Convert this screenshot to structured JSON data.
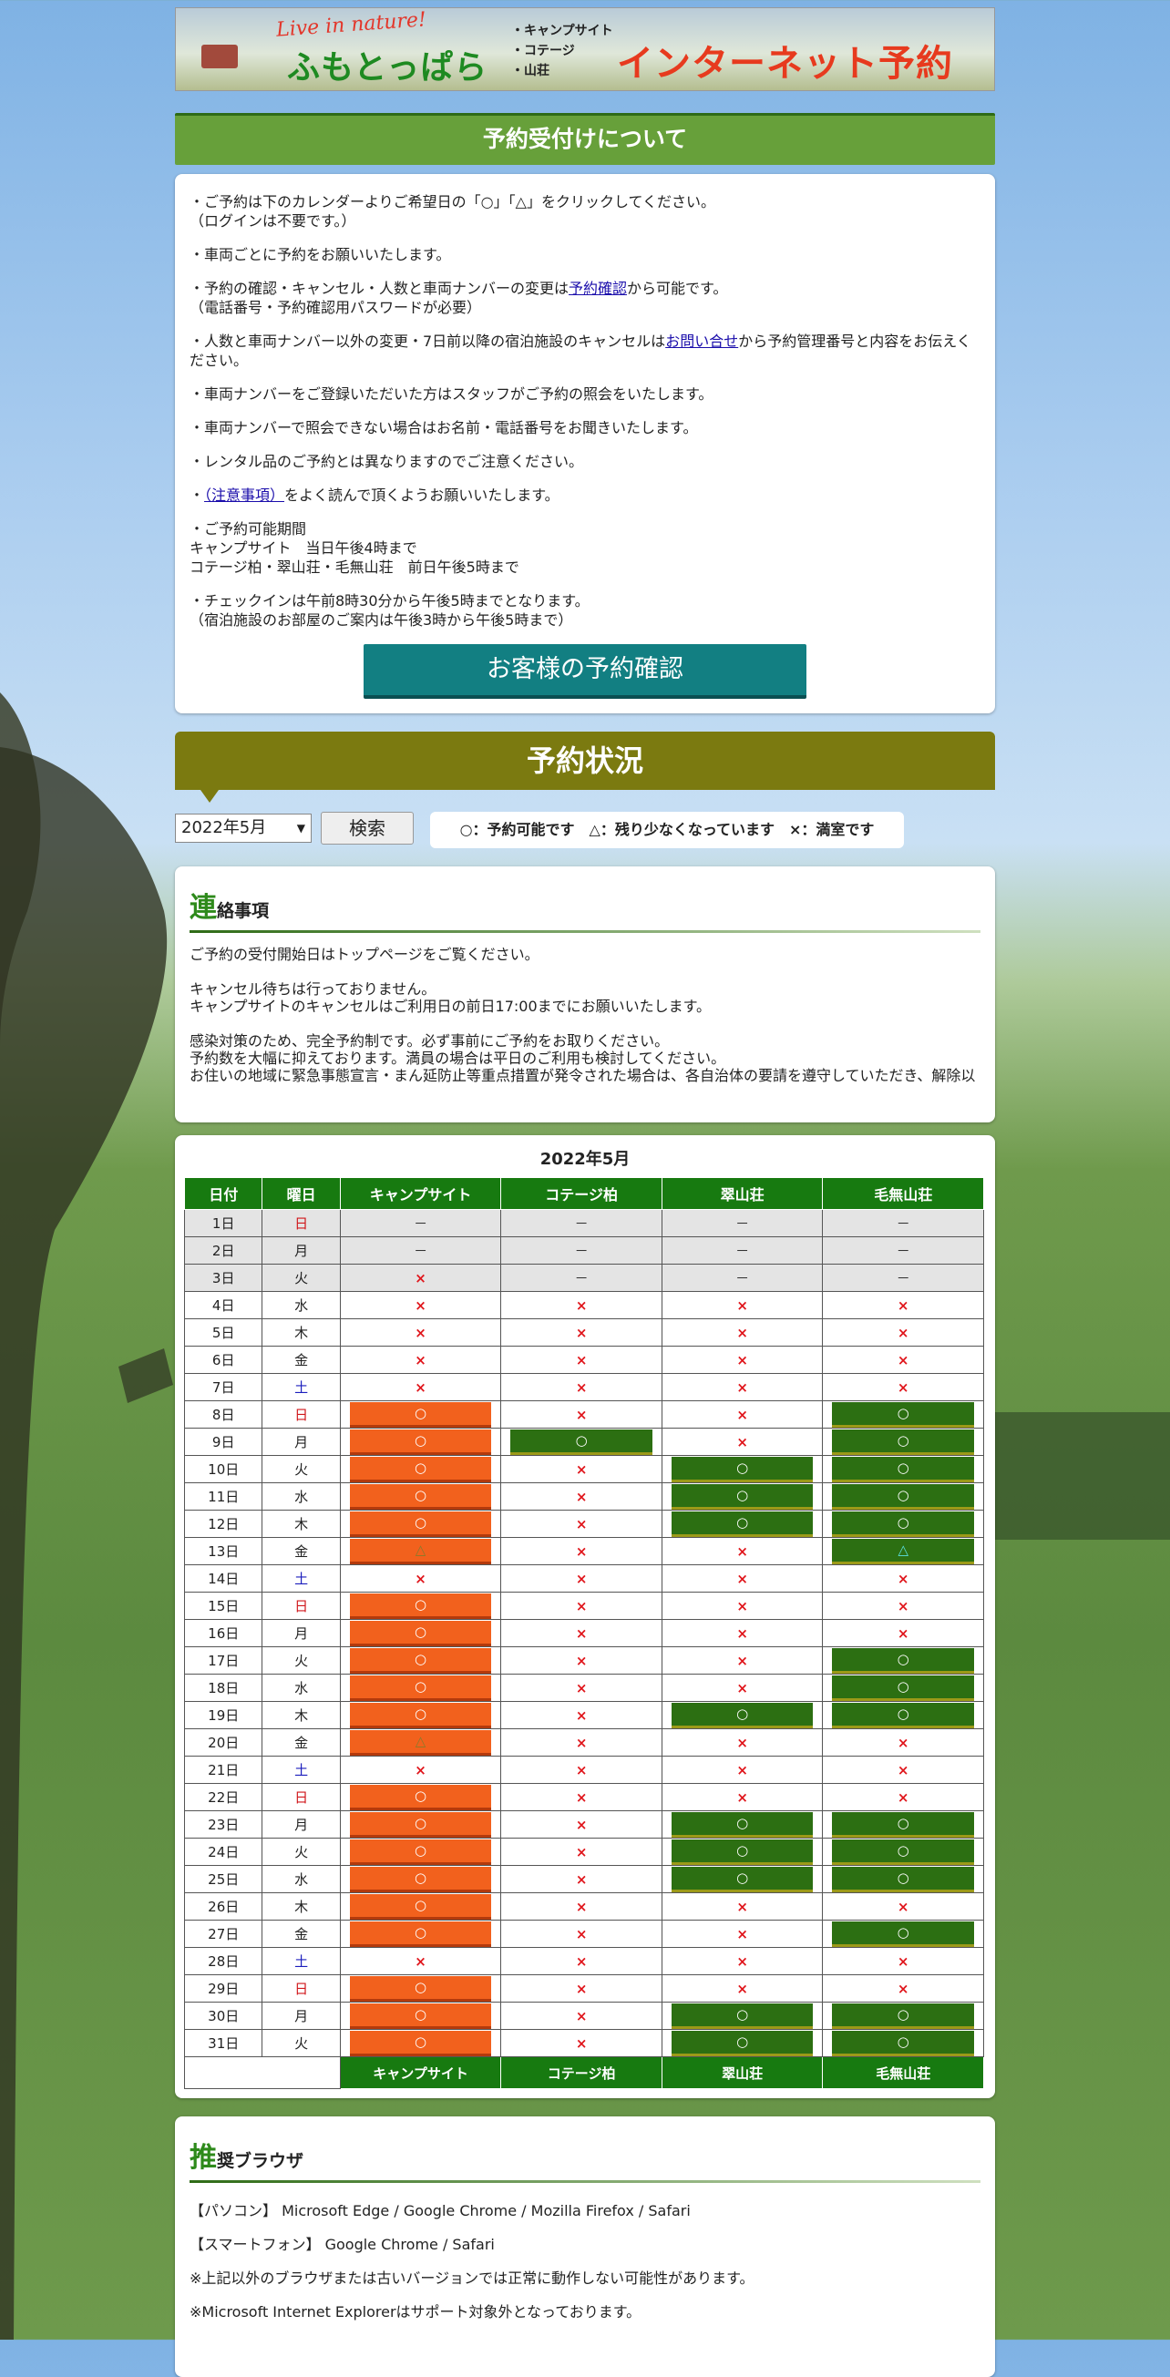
{
  "banner": {
    "tagline": "Live in nature!",
    "logo": "ふもとっぱら",
    "kinds": [
      "・キャンプサイト",
      "・コテージ",
      "・山荘"
    ],
    "title": "インターネット予約"
  },
  "reception": {
    "heading": "予約受付けについて",
    "paragraphs": [
      {
        "pre": "・ご予約は下のカレンダーよりご希望日の「○」「△」をクリックしてください。\n（ログインは不要です。）"
      },
      {
        "pre": "・車両ごとに予約をお願いいたします。"
      },
      {
        "pre": "・予約の確認・キャンセル・人数と車両ナンバーの変更は",
        "link": "予約確認",
        "post": "から可能です。\n（電話番号・予約確認用パスワードが必要）"
      },
      {
        "pre": "・人数と車両ナンバー以外の変更・7日前以降の宿泊施設のキャンセルは",
        "link": "お問い合せ",
        "post": "から予約管理番号と内容をお伝えください。"
      },
      {
        "pre": "・車両ナンバーをご登録いただいた方はスタッフがご予約の照会をいたします。"
      },
      {
        "pre": "・車両ナンバーで照会できない場合はお名前・電話番号をお聞きいたします。"
      },
      {
        "pre": "・レンタル品のご予約とは異なりますのでご注意ください。"
      },
      {
        "pre": "・",
        "link": "（注意事項）",
        "post": "をよく読んで頂くようお願いいたします。"
      },
      {
        "pre": "・ご予約可能期間\nキャンプサイト　当日午後4時まで\nコテージ柏・翠山荘・毛無山荘　前日午後5時まで"
      },
      {
        "pre": "・チェックインは午前8時30分から午後5時までとなります。\n（宿泊施設のお部屋のご案内は午後3時から午後5時まで）"
      }
    ],
    "confirm_button": "お客様の予約確認"
  },
  "status": {
    "heading": "予約状況",
    "month_selected": "2022年5月",
    "search_label": "検索",
    "legend": "○：予約可能です　△：残り少なくなっています　×：満室です"
  },
  "notice": {
    "heading_first": "連",
    "heading_rest": "絡事項",
    "body": "ご予約の受付開始日はトップページをご覧ください。\n\nキャンセル待ちは行っておりません。\nキャンプサイトのキャンセルはご利用日の前日17:00までにお願いいたします。\n\n感染対策のため、完全予約制です。必ず事前にご予約をお取りください。\n予約数を大幅に抑えております。満員の場合は平日のご利用も検討してください。\nお住いの地域に緊急事態宣言・まん延防止等重点措置が発令された場合は、各自治体の要請を遵守していただき、解除以"
  },
  "calendar": {
    "title": "2022年5月",
    "headers": [
      "日付",
      "曜日",
      "キャンプサイト",
      "コテージ柏",
      "翠山荘",
      "毛無山荘"
    ],
    "footer": [
      "キャンプサイト",
      "コテージ柏",
      "翠山荘",
      "毛無山荘"
    ],
    "symbols": {
      "o": "○",
      "t": "△",
      "x": "×",
      "-": "－"
    },
    "rows": [
      {
        "date": "1日",
        "wd": "日",
        "s": [
          "-",
          "-",
          "-",
          "-"
        ],
        "past": true
      },
      {
        "date": "2日",
        "wd": "月",
        "s": [
          "-",
          "-",
          "-",
          "-"
        ],
        "past": true
      },
      {
        "date": "3日",
        "wd": "火",
        "s": [
          "x",
          "-",
          "-",
          "-"
        ],
        "past": true
      },
      {
        "date": "4日",
        "wd": "水",
        "s": [
          "x",
          "x",
          "x",
          "x"
        ]
      },
      {
        "date": "5日",
        "wd": "木",
        "s": [
          "x",
          "x",
          "x",
          "x"
        ]
      },
      {
        "date": "6日",
        "wd": "金",
        "s": [
          "x",
          "x",
          "x",
          "x"
        ]
      },
      {
        "date": "7日",
        "wd": "土",
        "s": [
          "x",
          "x",
          "x",
          "x"
        ]
      },
      {
        "date": "8日",
        "wd": "日",
        "s": [
          "o",
          "x",
          "x",
          "o"
        ]
      },
      {
        "date": "9日",
        "wd": "月",
        "s": [
          "o",
          "o",
          "x",
          "o"
        ]
      },
      {
        "date": "10日",
        "wd": "火",
        "s": [
          "o",
          "x",
          "o",
          "o"
        ]
      },
      {
        "date": "11日",
        "wd": "水",
        "s": [
          "o",
          "x",
          "o",
          "o"
        ]
      },
      {
        "date": "12日",
        "wd": "木",
        "s": [
          "o",
          "x",
          "o",
          "o"
        ]
      },
      {
        "date": "13日",
        "wd": "金",
        "s": [
          "t",
          "x",
          "x",
          "t"
        ]
      },
      {
        "date": "14日",
        "wd": "土",
        "s": [
          "x",
          "x",
          "x",
          "x"
        ]
      },
      {
        "date": "15日",
        "wd": "日",
        "s": [
          "o",
          "x",
          "x",
          "x"
        ]
      },
      {
        "date": "16日",
        "wd": "月",
        "s": [
          "o",
          "x",
          "x",
          "x"
        ]
      },
      {
        "date": "17日",
        "wd": "火",
        "s": [
          "o",
          "x",
          "x",
          "o"
        ]
      },
      {
        "date": "18日",
        "wd": "水",
        "s": [
          "o",
          "x",
          "x",
          "o"
        ]
      },
      {
        "date": "19日",
        "wd": "木",
        "s": [
          "o",
          "x",
          "o",
          "o"
        ]
      },
      {
        "date": "20日",
        "wd": "金",
        "s": [
          "t",
          "x",
          "x",
          "x"
        ]
      },
      {
        "date": "21日",
        "wd": "土",
        "s": [
          "x",
          "x",
          "x",
          "x"
        ]
      },
      {
        "date": "22日",
        "wd": "日",
        "s": [
          "o",
          "x",
          "x",
          "x"
        ]
      },
      {
        "date": "23日",
        "wd": "月",
        "s": [
          "o",
          "x",
          "o",
          "o"
        ]
      },
      {
        "date": "24日",
        "wd": "火",
        "s": [
          "o",
          "x",
          "o",
          "o"
        ]
      },
      {
        "date": "25日",
        "wd": "水",
        "s": [
          "o",
          "x",
          "o",
          "o"
        ]
      },
      {
        "date": "26日",
        "wd": "木",
        "s": [
          "o",
          "x",
          "x",
          "x"
        ]
      },
      {
        "date": "27日",
        "wd": "金",
        "s": [
          "o",
          "x",
          "x",
          "o"
        ]
      },
      {
        "date": "28日",
        "wd": "土",
        "s": [
          "x",
          "x",
          "x",
          "x"
        ]
      },
      {
        "date": "29日",
        "wd": "日",
        "s": [
          "o",
          "x",
          "x",
          "x"
        ]
      },
      {
        "date": "30日",
        "wd": "月",
        "s": [
          "o",
          "x",
          "o",
          "o"
        ]
      },
      {
        "date": "31日",
        "wd": "火",
        "s": [
          "o",
          "x",
          "o",
          "o"
        ]
      }
    ]
  },
  "browsers": {
    "heading_first": "推",
    "heading_rest": "奨ブラウザ",
    "lines": [
      "【パソコン】 Microsoft Edge / Google Chrome / Mozilla Firefox / Safari",
      "【スマートフォン】 Google Chrome / Safari",
      "※上記以外のブラウザまたは古いバージョンでは正常に動作しない可能性があります。",
      "※Microsoft Internet Explorerはサポート対象外となっております。"
    ]
  },
  "colors": {
    "orange": "#f2611d",
    "green": "#2c6f12",
    "header_green": "#177a10",
    "olive": "#7b7a10",
    "teal": "#127f82"
  }
}
